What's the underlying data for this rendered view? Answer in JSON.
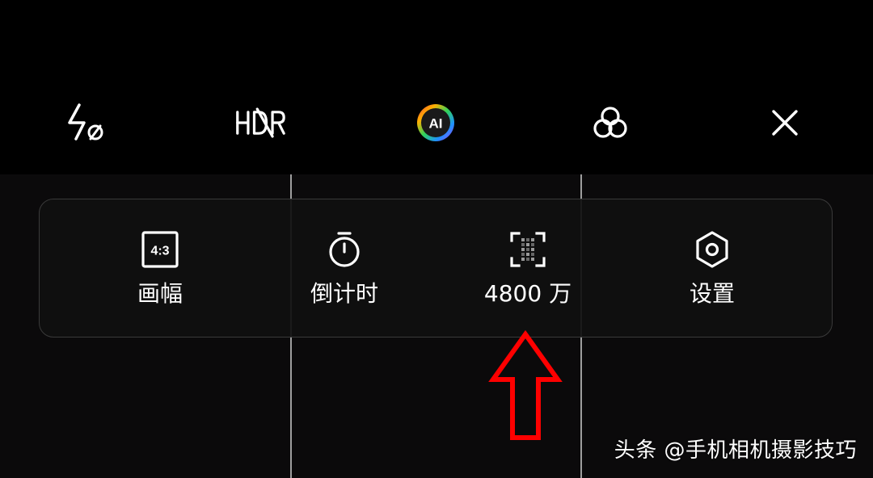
{
  "topbar": {
    "buttons": [
      {
        "name": "flash-off",
        "icon": "flash-off-icon"
      },
      {
        "name": "hdr",
        "icon": "hdr-off-icon"
      },
      {
        "name": "ai",
        "icon": "ai-icon",
        "label": "AI"
      },
      {
        "name": "filters",
        "icon": "filter-circles-icon"
      },
      {
        "name": "close",
        "icon": "close-icon"
      }
    ]
  },
  "menu": {
    "items": [
      {
        "label": "画幅",
        "icon": "aspect-ratio-icon",
        "icon_text": "4:3"
      },
      {
        "label": "倒计时",
        "icon": "timer-icon"
      },
      {
        "label": "4800 万",
        "icon": "resolution-grid-icon"
      },
      {
        "label": "设置",
        "icon": "settings-hex-icon"
      }
    ]
  },
  "annotation": {
    "arrow_color": "#ff0000",
    "arrow_direction": "up"
  },
  "watermark": {
    "text": "头条 @手机相机摄影技巧"
  },
  "colors": {
    "background": "#0b0a0b",
    "topbar": "#000000",
    "gridline": "#b9b9b9",
    "panel_border": "#3a3a3a"
  }
}
